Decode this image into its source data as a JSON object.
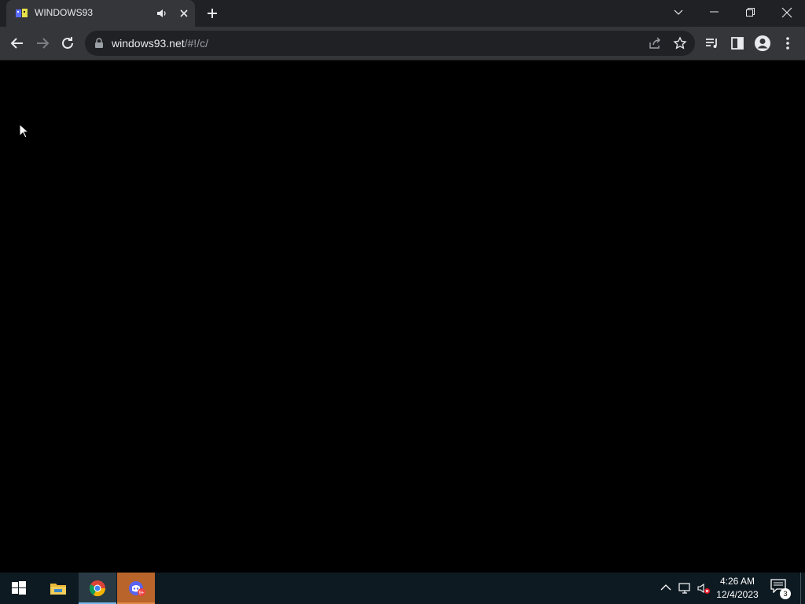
{
  "browser": {
    "tab": {
      "title": "WINDOWS93"
    },
    "address_bar": {
      "url_host": "windows93.net",
      "url_path": "/#!/c/"
    }
  },
  "icons": {
    "tab_favicon": "windows93-favicon-icon",
    "tab_audio": "speaker-icon",
    "tab_close": "close-icon",
    "new_tab": "plus-icon",
    "tab_search": "chevron-down-icon",
    "minimize": "minimize-icon",
    "restore": "restore-icon",
    "close_window": "close-icon",
    "back": "arrow-left-icon",
    "forward": "arrow-right-icon",
    "reload": "reload-icon",
    "lock": "lock-icon",
    "share": "share-icon",
    "bookmark": "star-icon",
    "media": "media-queue-icon",
    "side_panel": "side-panel-icon",
    "profile": "profile-icon",
    "menu": "kebab-menu-icon"
  },
  "taskbar": {
    "apps": [
      {
        "name": "start",
        "icon": "windows-logo-icon"
      },
      {
        "name": "file-explorer",
        "icon": "folder-icon"
      },
      {
        "name": "chrome",
        "icon": "chrome-icon"
      },
      {
        "name": "discord",
        "icon": "discord-icon",
        "badge": "9+"
      }
    ],
    "tray": {
      "icons": [
        "chevron-up-icon",
        "network-icon",
        "volume-muted-icon"
      ]
    },
    "clock": {
      "time": "4:26 AM",
      "date": "12/4/2023"
    },
    "notifications": {
      "count": "3"
    }
  },
  "colors": {
    "tabstrip": "#202124",
    "toolbar": "#35363a",
    "page": "#000000",
    "taskbar": "#0e1a22",
    "chrome_active_underline": "#76b9ed",
    "discord_task": "#b8642a"
  }
}
